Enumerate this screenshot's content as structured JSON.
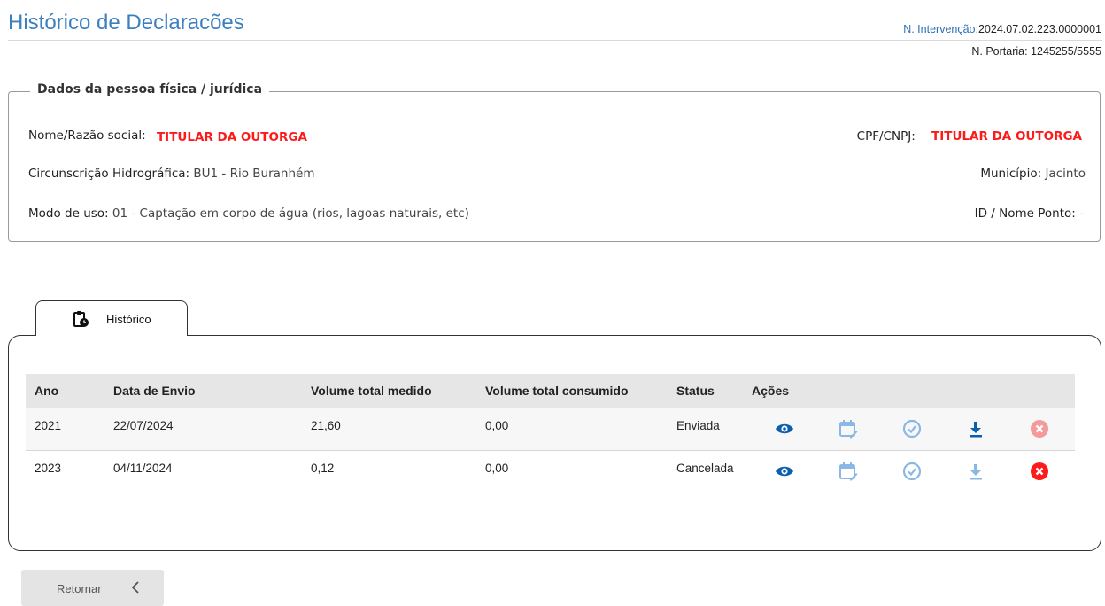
{
  "header": {
    "title": "Histórico de Declaracões",
    "intervencao_label": "N. Intervenção:",
    "intervencao_value": "2024.07.02.223.0000001",
    "portaria": "N. Portaria: 1245255/5555"
  },
  "person": {
    "legend": "Dados da pessoa física / jurídica",
    "nome_label": "Nome/Razão social:",
    "nome_value": "TITULAR DA OUTORGA",
    "cpf_label": "CPF/CNPJ:",
    "cpf_value": "TITULAR DA OUTORGA",
    "circ_label": "Circunscrição Hidrográfica:",
    "circ_value": "BU1 - Rio Buranhém",
    "municipio_label": "Município:",
    "municipio_value": "Jacinto",
    "modo_label": "Modo de uso:",
    "modo_value": "01 - Captação em corpo de água (rios, lagoas naturais, etc)",
    "ponto_label": "ID / Nome Ponto:",
    "ponto_value": "-"
  },
  "tab": {
    "label": "Histórico",
    "icon": "clipboard-clock-icon"
  },
  "table": {
    "headers": [
      "Ano",
      "Data de Envio",
      "Volume total medido",
      "Volume total consumido",
      "Status",
      "Ações"
    ],
    "rows": [
      {
        "ano": "2021",
        "data": "22/07/2024",
        "medido": "21,60",
        "consumido": "0,00",
        "status": "Enviada"
      },
      {
        "ano": "2023",
        "data": "04/11/2024",
        "medido": "0,12",
        "consumido": "0,00",
        "status": "Cancelada"
      }
    ]
  },
  "actions": {
    "view_icon": "eye-icon",
    "edit_icon": "calendar-edit-icon",
    "check_icon": "check-circle-icon",
    "download_icon": "download-icon",
    "cancel_icon": "cancel-circle-icon",
    "colors": {
      "primary": "#0b5fae",
      "light": "#8ab8e6",
      "red": "#ff1a1a",
      "red_light": "#f39a9a"
    }
  },
  "footer": {
    "return_label": "Retornar",
    "return_icon": "chevron-left-icon"
  }
}
